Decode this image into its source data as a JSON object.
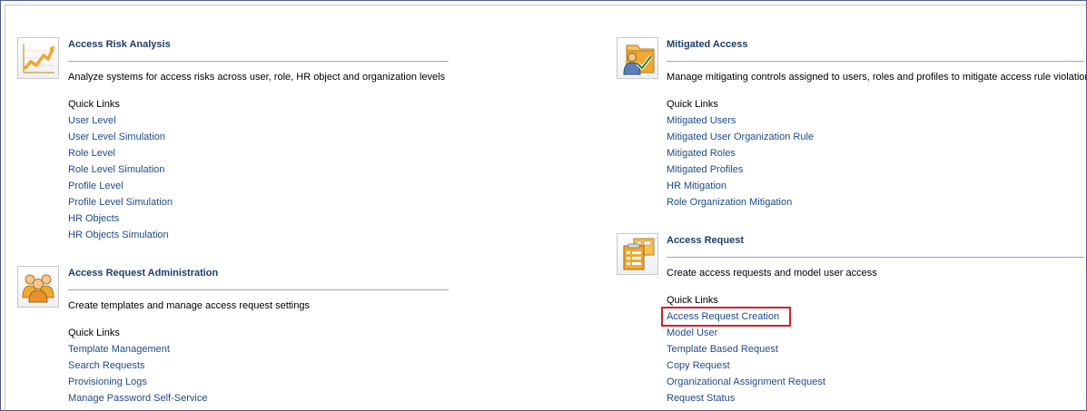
{
  "colors": {
    "title": "#1d3d6b",
    "link": "#1d4a8c",
    "rule": "#99a7c0",
    "highlight": "#d0222a",
    "icon_orange": "#f0a830"
  },
  "sections": {
    "access_risk_analysis": {
      "icon": "rising-chart-icon",
      "title": "Access Risk Analysis",
      "description": "Analyze systems for access risks across user, role, HR object and organization levels",
      "quick_links_label": "Quick Links",
      "links": [
        "User Level",
        "User Level Simulation",
        "Role Level",
        "Role Level Simulation",
        "Profile Level",
        "Profile Level Simulation",
        "HR Objects",
        "HR Objects Simulation"
      ]
    },
    "access_request_administration": {
      "icon": "user-group-icon",
      "title": "Access Request Administration",
      "description": "Create templates and manage access request settings",
      "quick_links_label": "Quick Links",
      "links": [
        "Template Management",
        "Search Requests",
        "Provisioning Logs",
        "Manage Password Self-Service"
      ]
    },
    "mitigated_access": {
      "icon": "user-folder-check-icon",
      "title": "Mitigated Access",
      "description": "Manage mitigating controls assigned to users, roles and profiles to mitigate access rule violations",
      "quick_links_label": "Quick Links",
      "links": [
        "Mitigated Users",
        "Mitigated User Organization Rule",
        "Mitigated Roles",
        "Mitigated Profiles",
        "HR Mitigation",
        "Role Organization Mitigation"
      ]
    },
    "access_request": {
      "icon": "request-forms-icon",
      "title": "Access Request",
      "description": "Create access requests and model user access",
      "quick_links_label": "Quick Links",
      "links": [
        "Access Request Creation",
        "Model User",
        "Template Based Request",
        "Copy Request",
        "Organizational Assignment Request",
        "Request Status"
      ]
    }
  }
}
